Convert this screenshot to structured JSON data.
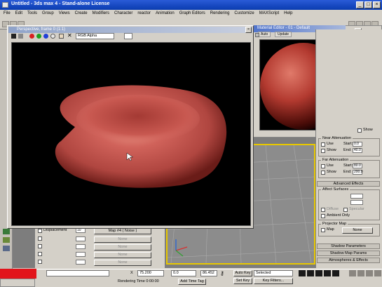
{
  "window": {
    "title": "Untitled - 3ds max 4 - Stand-alone License",
    "min": "_",
    "max": "□",
    "close": "×"
  },
  "menu": [
    "File",
    "Edit",
    "Tools",
    "Group",
    "Views",
    "Create",
    "Modifiers",
    "Character",
    "reactor",
    "Animation",
    "Graph Editors",
    "Rendering",
    "Customize",
    "MAXScript",
    "Help"
  ],
  "frame_window": {
    "title": "Perspective, frame 0 (1:1)",
    "channel": "RGB Alpha",
    "close": "×"
  },
  "material_editor": {
    "title": "Material Editor - 01 - Default",
    "tabs": [
      "Auto",
      "Update"
    ]
  },
  "command_panel": {
    "near_atten": {
      "title": "Near Attenuation",
      "use": "Use",
      "start": "Start:",
      "start_val": "0.0",
      "show": "Show",
      "end": "End:",
      "end_val": "40.0"
    },
    "far_atten": {
      "title": "Far Attenuation",
      "use": "Use",
      "start": "Start:",
      "start_val": "80.0",
      "show": "Show",
      "end": "End:",
      "end_val": "200.0"
    },
    "advanced_effects": "Advanced Effects",
    "affect_surfaces": {
      "title": "Affect Surfaces",
      "diffuse": "Diffuse",
      "specular": "Specular",
      "ambient_only": "Ambient Only"
    },
    "projector_map": {
      "title": "Projector Map",
      "map": "Map",
      "none": "None"
    },
    "rollouts": [
      "Shadow Parameters",
      "Shadow Map Params",
      "Atmospheres & Effects"
    ],
    "show_label": "Show"
  },
  "params_panel": {
    "displacement_label": "Displacement",
    "displacement_amount": "10",
    "displacement_map": "Map #4 ( Noise )",
    "none_label": "None",
    "empty_slot_rows": [
      "None",
      "None",
      "None",
      "None"
    ]
  },
  "statusbar": {
    "coord_x": "75.200",
    "coord_y": "0.0",
    "coord_z": "86.452",
    "auto_key": "Auto Key",
    "selected": "Selected",
    "set_key": "Set Key",
    "key_filters": "Key Filters...",
    "rendering_time": "Rendering Time 0:00:00",
    "add_time_tag": "Add Time Tag"
  },
  "colors": {
    "viewport_border": "#e8c800",
    "rbc": "#c94d42",
    "status_red": "#e2141b"
  }
}
